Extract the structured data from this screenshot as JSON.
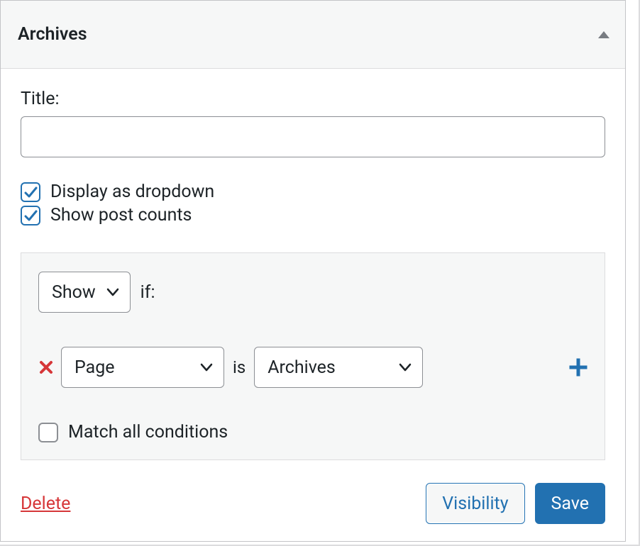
{
  "widget": {
    "title": "Archives"
  },
  "form": {
    "title_label": "Title:",
    "title_value": "",
    "display_dropdown_label": "Display as dropdown",
    "display_dropdown_checked": true,
    "show_post_counts_label": "Show post counts",
    "show_post_counts_checked": true
  },
  "conditions": {
    "action_value": "Show",
    "if_text": "if:",
    "rule": {
      "subject_value": "Page",
      "is_text": "is",
      "object_value": "Archives"
    },
    "match_all_label": "Match all conditions",
    "match_all_checked": false
  },
  "footer": {
    "delete_label": "Delete",
    "visibility_label": "Visibility",
    "save_label": "Save"
  }
}
